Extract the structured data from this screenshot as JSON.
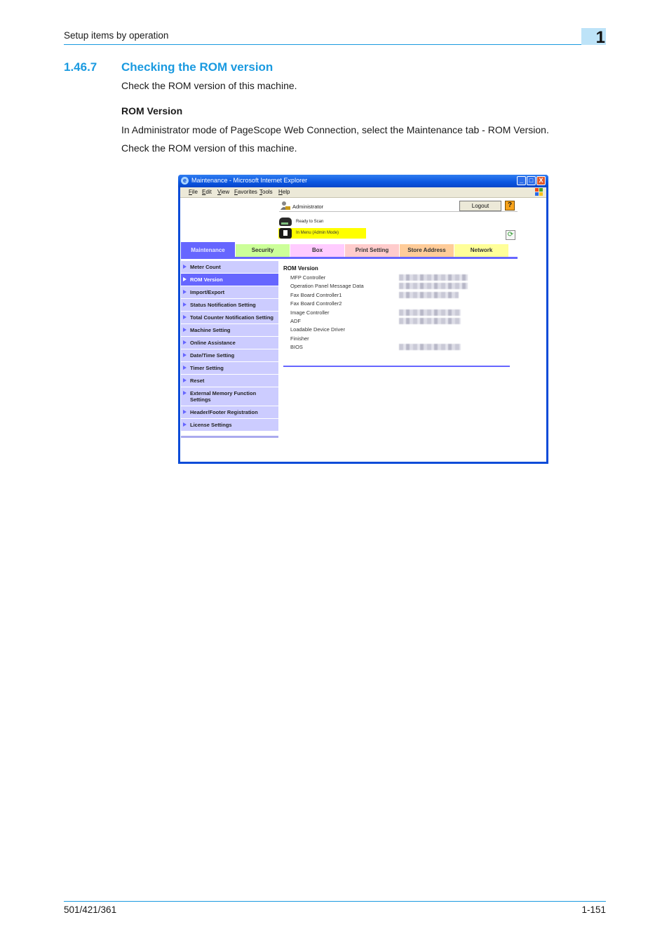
{
  "page": {
    "running_header": "Setup items by operation",
    "chapter_number": "1",
    "section_number": "1.46.7",
    "section_title": "Checking the ROM version",
    "intro": "Check the ROM version of this machine.",
    "subheading": "ROM Version",
    "instruction": "In Administrator mode of PageScope Web Connection, select the Maintenance tab - ROM Version.",
    "instruction2": "Check the ROM version of this machine.",
    "footer_model": "501/421/361",
    "footer_page": "1-151",
    "accent_color": "#1a9ae0"
  },
  "browser": {
    "title": "Maintenance - Microsoft Internet Explorer",
    "window_buttons": {
      "minimize": "_",
      "maximize": "□",
      "close": "X"
    },
    "menu": [
      "File",
      "Edit",
      "View",
      "Favorites",
      "Tools",
      "Help"
    ],
    "user": "Administrator",
    "logout_label": "Logout",
    "help_label": "?",
    "status_scan": "Ready to Scan",
    "status_mode": "In Menu (Admin Mode)",
    "refresh_icon": "⟳",
    "tabs": [
      {
        "label": "Maintenance",
        "color": "#6666ff",
        "active": true
      },
      {
        "label": "Security",
        "color": "#ccff99"
      },
      {
        "label": "Box",
        "color": "#ffccff"
      },
      {
        "label": "Print Setting",
        "color": "#ffcccc"
      },
      {
        "label": "Store Address",
        "color": "#ffcc99"
      },
      {
        "label": "Network",
        "color": "#ffff99"
      }
    ],
    "sidebar": [
      "Meter Count",
      "ROM Version",
      "Import/Export",
      "Status Notification Setting",
      "Total Counter Notification Setting",
      "Machine Setting",
      "Online Assistance",
      "Date/Time Setting",
      "Timer Setting",
      "Reset",
      "External Memory Function Settings",
      "Header/Footer Registration",
      "License Settings"
    ],
    "sidebar_active": "ROM Version",
    "content_title": "ROM Version",
    "rom_rows": [
      {
        "label": "MFP Controller",
        "value_blurred": true
      },
      {
        "label": "Operation Panel Message Data",
        "value_blurred": true
      },
      {
        "label": "Fax Board Controller1",
        "value_blurred": true
      },
      {
        "label": "Fax Board Controller2",
        "value_blurred": false
      },
      {
        "label": "Image Controller",
        "value_blurred": true
      },
      {
        "label": "ADF",
        "value_blurred": true
      },
      {
        "label": "Loadable Device Driver",
        "value_blurred": false
      },
      {
        "label": "Finisher",
        "value_blurred": false
      },
      {
        "label": "BIOS",
        "value_blurred": true
      }
    ]
  }
}
